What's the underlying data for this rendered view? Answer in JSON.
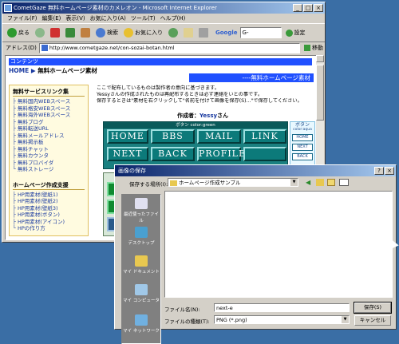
{
  "browser": {
    "title": "CometGaze  無料ホームページ素材のカメレオン - Microsoft Internet Explorer",
    "menu": [
      "ファイル(F)",
      "編集(E)",
      "表示(V)",
      "お気に入り(A)",
      "ツール(T)",
      "ヘルプ(H)"
    ],
    "toolbar": {
      "back": "戻る",
      "search": "検索",
      "favorites": "お気に入り",
      "settings": "設定"
    },
    "google_label": "Google",
    "google_value": "G-",
    "address_label": "アドレス(D)",
    "address": "http://www.cometgaze.net/con-sozai-botan.html",
    "go": "移動"
  },
  "page": {
    "header_bar": "コンテンツ",
    "breadcrumb_home": "HOME",
    "breadcrumb_current": "無料ホームページ素材",
    "right_title": "----無料ホームページ素材",
    "link_section_title": "無料サービスリンク集",
    "links": [
      "無料国内WEBスペース",
      "無料格安WEBスペース",
      "無料海外WEBスペース",
      "無料ブログ",
      "無料転送URL",
      "無料メールアドレス",
      "無料掲示板",
      "無料チャット",
      "無料カウンタ",
      "無料プロバイダ",
      "無料ストレージ"
    ],
    "support_section_title": "ホームページ作成支援",
    "support_links": [
      "HP用素材(壁紙1)",
      "HP用素材(壁紙2)",
      "HP用素材(壁紙3)",
      "HP用素材(ボタン)",
      "HP用素材(アイコン)",
      "HPの作り方"
    ],
    "notice_1": "ここで配布しているものは製作者の意向に基づきます。",
    "notice_2": "Yessyさんの作成されたものは再配布するときは必ず連絡をいとの事です。",
    "notice_3": "保存するときは\"素材を右クリックして\"名前を付けて画像を保存(S)...\"で保存してください。",
    "author_label": "作成者：",
    "author_name": "Yessy",
    "author_suffix": "さん",
    "button_panel_caption": "ボタン color:green",
    "buttons_row1": [
      "HOME",
      "BBS",
      "MAIL",
      "LINK"
    ],
    "buttons_row2": [
      "NEXT",
      "BACK",
      "PROFILE",
      ""
    ],
    "side_caption": "ボタン",
    "side_subcaption": "color:aqua",
    "side_buttons": [
      "HOME",
      "NEXT",
      "BACK"
    ]
  },
  "dialog": {
    "title": "画像の保存",
    "save_in_label": "保存する場所(I):",
    "save_in_value": "ホームページ作成サンプル",
    "places": [
      "最近使ったファイル",
      "デスクトップ",
      "マイ ドキュメント",
      "マイ コンピュータ",
      "マイ ネットワーク"
    ],
    "filename_label": "ファイル名(N):",
    "filename_value": "next-e",
    "filetype_label": "ファイルの種類(T):",
    "filetype_value": "PNG (*.png)",
    "save_button": "保存(S)",
    "cancel_button": "キャンセル",
    "help_btn": "?",
    "close_btn": "×"
  },
  "colors": {
    "desktop": "#3a6ea5",
    "title_blue": "#0a246a",
    "button_teal": "#0c7a7a",
    "link_blue": "#1a3aa0"
  }
}
